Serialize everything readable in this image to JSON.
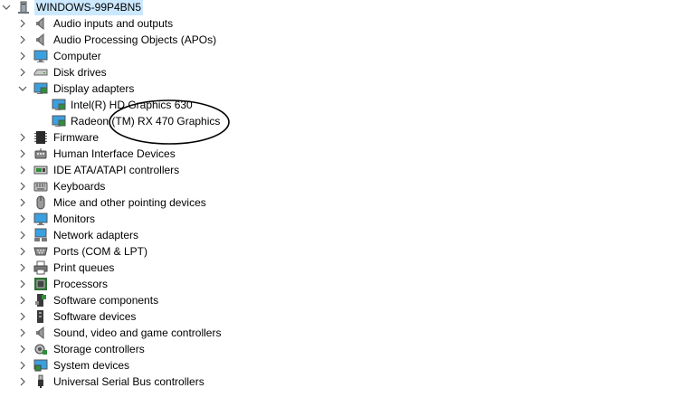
{
  "root": {
    "label": "WINDOWS-99P4BN5",
    "icon": "computer-icon",
    "expanded": true
  },
  "categories": [
    {
      "label": "Audio inputs and outputs",
      "icon": "speaker-icon"
    },
    {
      "label": "Audio Processing Objects (APOs)",
      "icon": "speaker-icon"
    },
    {
      "label": "Computer",
      "icon": "monitor-icon"
    },
    {
      "label": "Disk drives",
      "icon": "disk-drive-icon"
    },
    {
      "label": "Display adapters",
      "icon": "display-adapter-icon",
      "expanded": true,
      "children": [
        {
          "label": "Intel(R) HD Graphics 630",
          "icon": "display-adapter-icon"
        },
        {
          "label": "Radeon (TM) RX 470 Graphics",
          "icon": "display-adapter-icon"
        }
      ]
    },
    {
      "label": "Firmware",
      "icon": "firmware-chip-icon"
    },
    {
      "label": "Human Interface Devices",
      "icon": "hid-icon"
    },
    {
      "label": "IDE ATA/ATAPI controllers",
      "icon": "ide-controller-icon"
    },
    {
      "label": "Keyboards",
      "icon": "keyboard-icon"
    },
    {
      "label": "Mice and other pointing devices",
      "icon": "mouse-icon"
    },
    {
      "label": "Monitors",
      "icon": "monitor-icon"
    },
    {
      "label": "Network adapters",
      "icon": "network-adapter-icon"
    },
    {
      "label": "Ports (COM & LPT)",
      "icon": "port-icon"
    },
    {
      "label": "Print queues",
      "icon": "printer-icon"
    },
    {
      "label": "Processors",
      "icon": "processor-icon"
    },
    {
      "label": "Software components",
      "icon": "software-component-icon"
    },
    {
      "label": "Software devices",
      "icon": "software-device-icon"
    },
    {
      "label": "Sound, video and game controllers",
      "icon": "speaker-icon"
    },
    {
      "label": "Storage controllers",
      "icon": "storage-controller-icon"
    },
    {
      "label": "System devices",
      "icon": "system-device-icon"
    },
    {
      "label": "Universal Serial Bus controllers",
      "icon": "usb-icon"
    }
  ],
  "colors": {
    "selection": "#cce8ff",
    "chevron": "#555555",
    "annotation": "#000000"
  }
}
